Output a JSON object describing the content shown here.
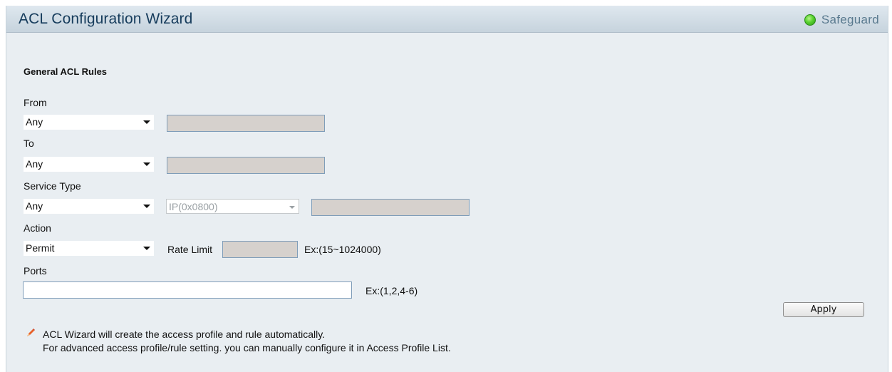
{
  "window": {
    "title": "ACL Configuration Wizard",
    "safeguard": "Safeguard"
  },
  "section": {
    "heading": "General ACL Rules"
  },
  "from": {
    "label": "From",
    "selected": "Any"
  },
  "to": {
    "label": "To",
    "selected": "Any"
  },
  "service_type": {
    "label": "Service Type",
    "selected": "Any",
    "ethertype": "IP(0x0800)"
  },
  "action": {
    "label": "Action",
    "selected": "Permit",
    "rate_limit_label": "Rate Limit",
    "rate_limit_hint": "Ex:(15~1024000)"
  },
  "ports": {
    "label": "Ports",
    "value": "",
    "hint": "Ex:(1,2,4-6)"
  },
  "buttons": {
    "apply": "Apply"
  },
  "note": {
    "line1": "ACL Wizard will create the access profile and rule automatically.",
    "line2": "For advanced access profile/rule setting. you can manually configure it in Access Profile List."
  },
  "colors": {
    "title_text": "#163c5c",
    "status_green": "#58d12f",
    "field_border": "#7f9db9"
  },
  "icons": {
    "status": "green-status-dot-icon",
    "note": "pencil-icon"
  }
}
